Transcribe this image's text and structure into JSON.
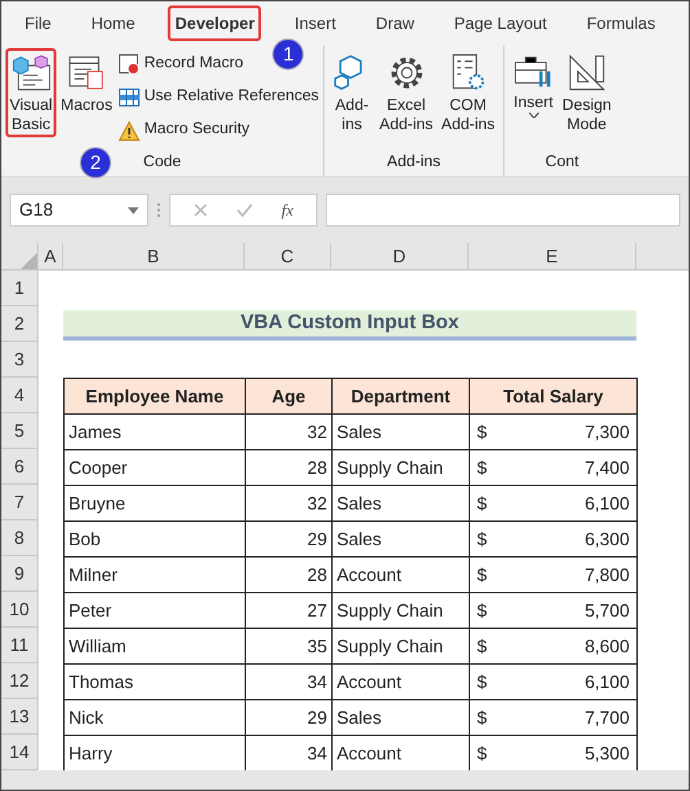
{
  "ribbon_tabs": [
    {
      "label": "File",
      "selected": false,
      "highlighted": false
    },
    {
      "label": "Home",
      "selected": false,
      "highlighted": false
    },
    {
      "label": "Developer",
      "selected": true,
      "highlighted": true
    },
    {
      "label": "Insert",
      "selected": false,
      "highlighted": false
    },
    {
      "label": "Draw",
      "selected": false,
      "highlighted": false
    },
    {
      "label": "Page Layout",
      "selected": false,
      "highlighted": false
    },
    {
      "label": "Formulas",
      "selected": false,
      "highlighted": false
    }
  ],
  "ribbon_groups": [
    {
      "label": "Code",
      "large_buttons": [
        {
          "label": "Visual Basic",
          "highlighted": true,
          "callout": "2"
        },
        {
          "label": "Macros",
          "highlighted": false
        }
      ],
      "small_buttons": [
        {
          "label": "Record Macro"
        },
        {
          "label": "Use Relative References"
        },
        {
          "label": "Macro Security"
        }
      ]
    },
    {
      "label": "Add-ins",
      "large_buttons": [
        {
          "label": "Add-ins",
          "highlighted": false
        },
        {
          "label": "Excel Add-ins",
          "highlighted": false
        },
        {
          "label": "COM Add-ins",
          "highlighted": false
        }
      ]
    },
    {
      "label": "Cont",
      "large_buttons": [
        {
          "label": "Insert",
          "highlighted": false,
          "dropdown": true
        },
        {
          "label": "Design Mode",
          "highlighted": false,
          "dropdown": false
        }
      ]
    }
  ],
  "tab_callout": "1",
  "name_box": "G18",
  "formula_bar": {
    "fx": "fx"
  },
  "columns": [
    "A",
    "B",
    "C",
    "D",
    "E"
  ],
  "row_numbers": [
    "1",
    "2",
    "3",
    "4",
    "5",
    "6",
    "7",
    "8",
    "9",
    "10",
    "11",
    "12",
    "13",
    "14"
  ],
  "sheet_title": "VBA Custom Input Box",
  "table": {
    "columns": [
      "Employee Name",
      "Age",
      "Department",
      "Total Salary"
    ],
    "rows": [
      {
        "name": "James",
        "age": "32",
        "department": "Sales",
        "currency": "$",
        "salary": "7,300"
      },
      {
        "name": "Cooper",
        "age": "28",
        "department": "Supply Chain",
        "currency": "$",
        "salary": "7,400"
      },
      {
        "name": "Bruyne",
        "age": "32",
        "department": "Sales",
        "currency": "$",
        "salary": "6,100"
      },
      {
        "name": "Bob",
        "age": "29",
        "department": "Sales",
        "currency": "$",
        "salary": "6,300"
      },
      {
        "name": "Milner",
        "age": "28",
        "department": "Account",
        "currency": "$",
        "salary": "7,800"
      },
      {
        "name": "Peter",
        "age": "27",
        "department": "Supply Chain",
        "currency": "$",
        "salary": "5,700"
      },
      {
        "name": "William",
        "age": "35",
        "department": "Supply Chain",
        "currency": "$",
        "salary": "8,600"
      },
      {
        "name": "Thomas",
        "age": "34",
        "department": "Account",
        "currency": "$",
        "salary": "6,100"
      },
      {
        "name": "Nick",
        "age": "29",
        "department": "Sales",
        "currency": "$",
        "salary": "7,700"
      },
      {
        "name": "Harry",
        "age": "34",
        "department": "Account",
        "currency": "$",
        "salary": "5,300"
      }
    ]
  }
}
